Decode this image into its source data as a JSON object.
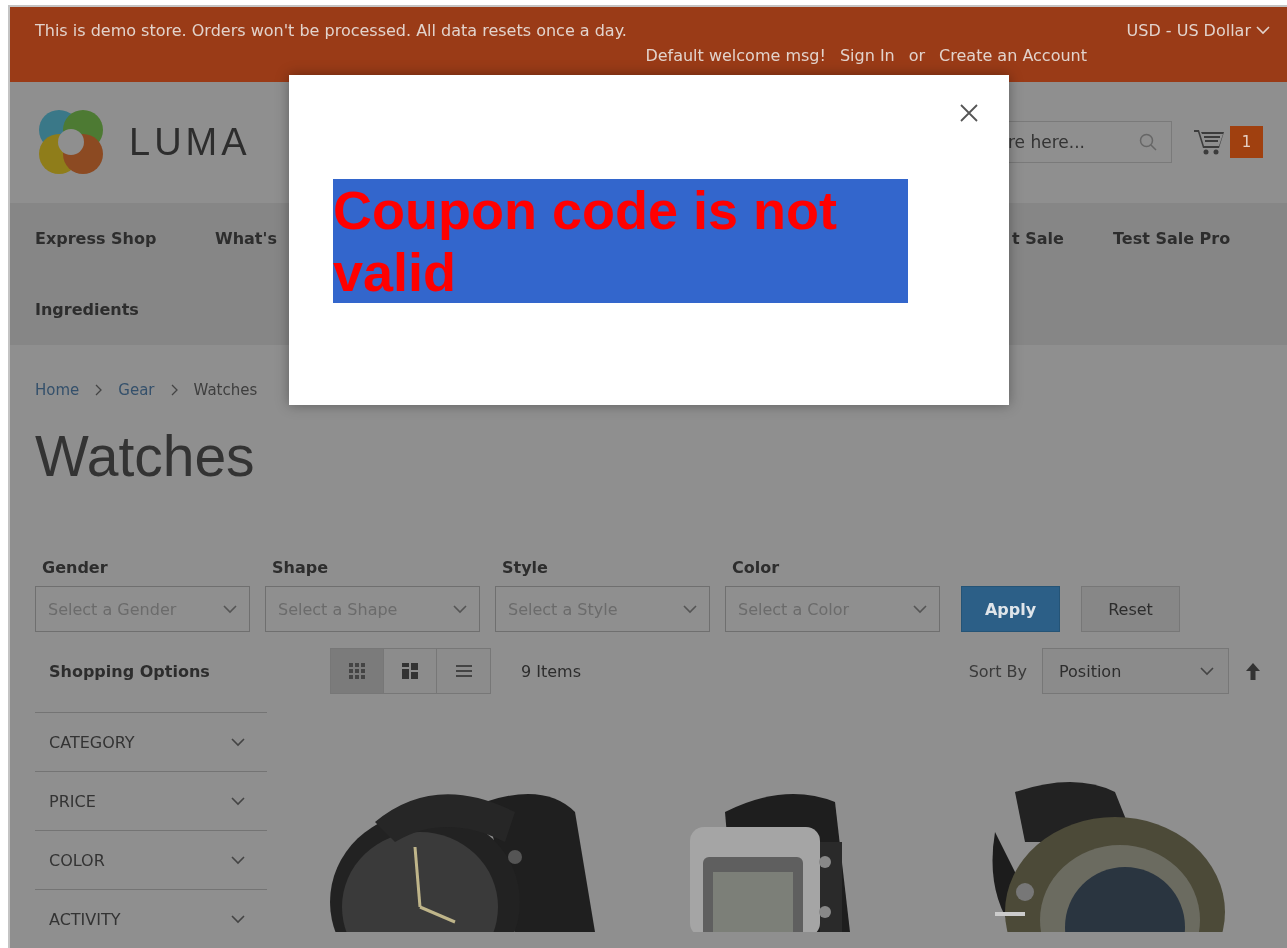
{
  "top_bar": {
    "notice": "This is demo store. Orders won't be processed. All data resets once a day.",
    "currency": "USD - US Dollar",
    "welcome": "Default welcome msg!",
    "sign_in": "Sign In",
    "separator": "or",
    "create_account": "Create an Account"
  },
  "header": {
    "logo_text": "LUMA",
    "search": {
      "value": "re here..."
    },
    "cart_count": "1"
  },
  "nav_rows": [
    [
      {
        "label": "Express Shop"
      },
      {
        "label": "What's"
      },
      {
        "label": "t Sale"
      },
      {
        "label": "Test Sale Pro"
      }
    ],
    [
      {
        "label": "Ingredients"
      }
    ]
  ],
  "breadcrumbs": [
    {
      "label": "Home",
      "link": true
    },
    {
      "label": "Gear",
      "link": true
    },
    {
      "label": "Watches",
      "link": false
    }
  ],
  "page_title": "Watches",
  "filters": [
    {
      "label": "Gender",
      "prompt": "Select a Gender"
    },
    {
      "label": "Shape",
      "prompt": "Select a Shape"
    },
    {
      "label": "Style",
      "prompt": "Select a Style"
    },
    {
      "label": "Color",
      "prompt": "Select a Color"
    }
  ],
  "filter_buttons": [
    {
      "label": "Apply",
      "kind": "primary"
    },
    {
      "label": "Reset",
      "kind": "secondary"
    }
  ],
  "toolbar": {
    "heading": "Shopping Options",
    "view_modes": [
      {
        "kind": "grid",
        "selected": true
      },
      {
        "kind": "tiles",
        "selected": false
      },
      {
        "kind": "list",
        "selected": false
      }
    ],
    "item_count": "9 Items",
    "sort_label": "Sort By",
    "sort_value": "Position"
  },
  "sidebar_filters": [
    {
      "label": "CATEGORY"
    },
    {
      "label": "PRICE"
    },
    {
      "label": "COLOR"
    },
    {
      "label": "ACTIVITY"
    }
  ],
  "products": [
    {
      "kind": "picture"
    },
    {
      "kind": "picture"
    },
    {
      "kind": "picture"
    }
  ],
  "modal": {
    "message": "Coupon code is not valid"
  }
}
